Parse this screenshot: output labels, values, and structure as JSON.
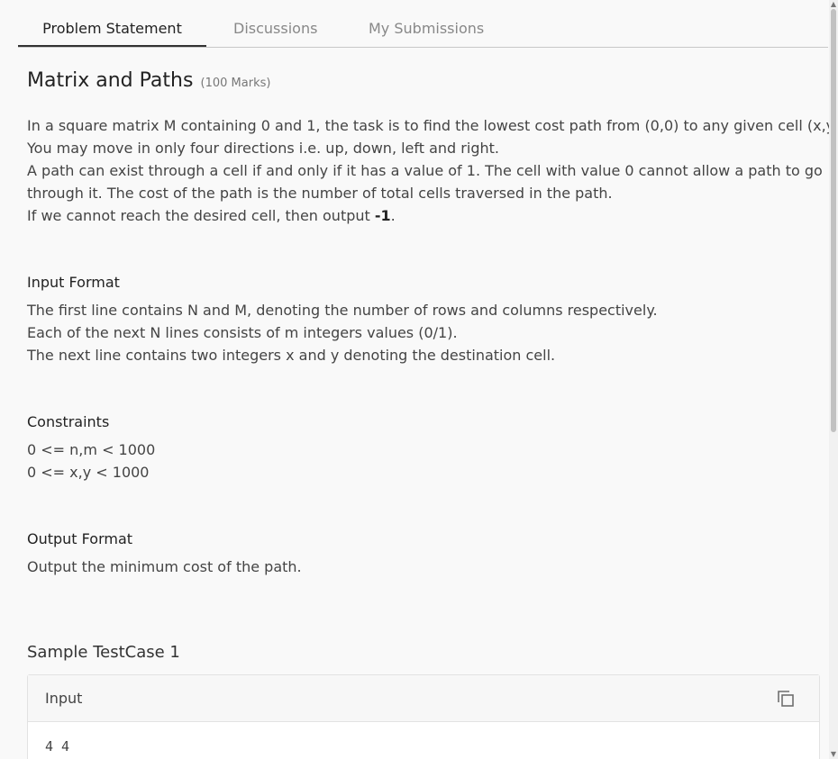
{
  "tabs": [
    {
      "label": "Problem Statement",
      "active": true
    },
    {
      "label": "Discussions",
      "active": false
    },
    {
      "label": "My Submissions",
      "active": false
    }
  ],
  "problem": {
    "title": "Matrix and Paths",
    "marks": "(100 Marks)",
    "statement_lines": [
      "In a square matrix M containing 0 and 1, the task is to find the lowest cost path from (0,0) to any given cell (x,y).",
      "You may move in only four directions i.e. up, down, left and right.",
      "A path can exist through a cell if and only if it has a value of 1. The cell with value 0 cannot allow a path to go",
      "through it. The cost of the path is the number of total cells traversed in the path."
    ],
    "last_line_prefix": "If we cannot reach the desired cell, then output ",
    "last_line_bold": "-1",
    "last_line_suffix": "."
  },
  "input_format": {
    "heading": "Input Format",
    "lines": [
      "The first line contains N and M, denoting the number of rows and columns respectively.",
      "Each of the next N lines consists of m integers values (0/1).",
      "The next line contains two integers x and y denoting the destination cell."
    ]
  },
  "constraints": {
    "heading": "Constraints",
    "lines": [
      "0 <= n,m < 1000",
      "0 <= x,y < 1000"
    ]
  },
  "output_format": {
    "heading": "Output Format",
    "lines": [
      "Output the minimum cost of the path."
    ]
  },
  "sample": {
    "title": "Sample TestCase 1",
    "input_label": "Input",
    "copy_icon": "copy-icon",
    "input_first_line": "4 4"
  }
}
